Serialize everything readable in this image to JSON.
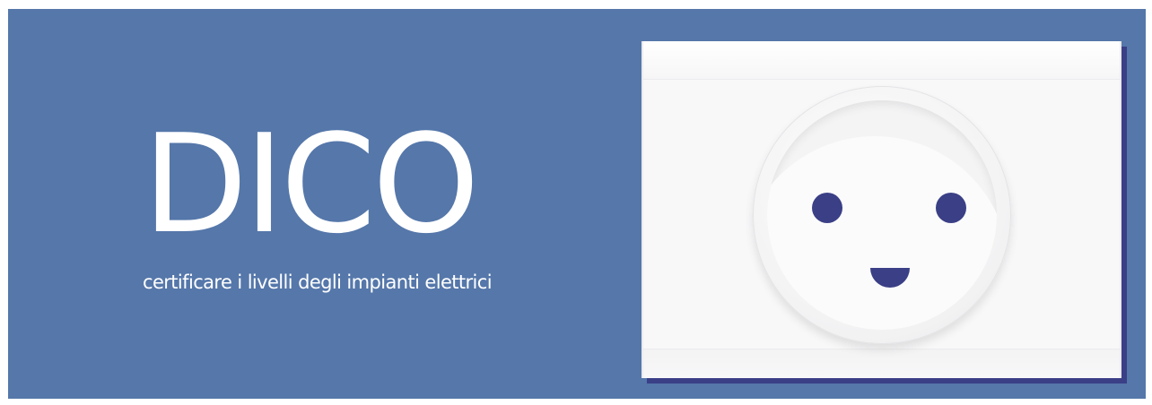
{
  "banner": {
    "title": "DICO",
    "subtitle": "certificare i livelli degli impianti elettrici",
    "background_color": "#5577aa",
    "text_color": "#ffffff"
  },
  "illustration": {
    "subject": "smiling electrical socket on a white wall plate",
    "icon": "socket-face-icon",
    "plate_color": "#f8f8f9",
    "shadow_color": "#3a3f86",
    "features_color": "#3a3f86"
  }
}
